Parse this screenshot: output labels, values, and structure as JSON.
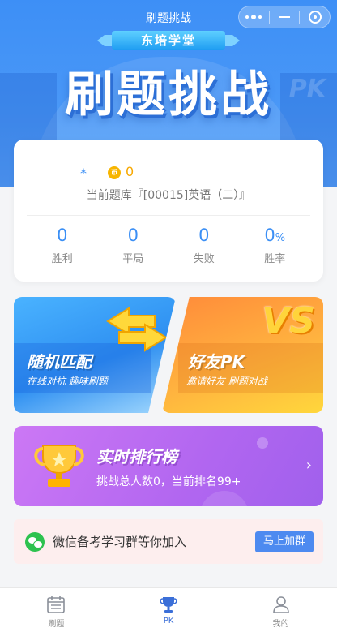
{
  "nav": {
    "title": "刷题挑战"
  },
  "header": {
    "brand_ribbon": "东培学堂",
    "hero_title": "刷题挑战",
    "background_text": "PK"
  },
  "stats": {
    "user_name": "*",
    "coin_icon_text": "币",
    "coins": "0",
    "question_bank": "当前题库『[00015]英语（二）』",
    "items": [
      {
        "value": "0",
        "unit": "",
        "label": "胜利"
      },
      {
        "value": "0",
        "unit": "",
        "label": "平局"
      },
      {
        "value": "0",
        "unit": "",
        "label": "失败"
      },
      {
        "value": "0",
        "unit": "%",
        "label": "胜率"
      }
    ]
  },
  "modes": {
    "random": {
      "title": "随机匹配",
      "subtitle": "在线对抗 趣味刷题"
    },
    "friend": {
      "title": "好友PK",
      "subtitle": "邀请好友 刷题对战",
      "badge": "VS"
    }
  },
  "ranking": {
    "title": "实时排行榜",
    "subtitle": "挑战总人数0，当前排名99+",
    "arrow": "›"
  },
  "wechat": {
    "text": "微信备考学习群等你加入",
    "button": "马上加群"
  },
  "tabbar": {
    "items": [
      {
        "label": "刷题",
        "icon": "calendar-icon",
        "active": false
      },
      {
        "label": "PK",
        "icon": "trophy-icon",
        "active": true
      },
      {
        "label": "我的",
        "icon": "user-icon",
        "active": false
      }
    ]
  },
  "colors": {
    "primary": "#3b8ff5",
    "coin": "#f7a800",
    "random_card": "#2e8ff1",
    "friend_card": "#ffb23f",
    "ranking_card": "#b166f0",
    "wechat_button": "#4d8af0",
    "tab_active": "#3b6fd8"
  }
}
